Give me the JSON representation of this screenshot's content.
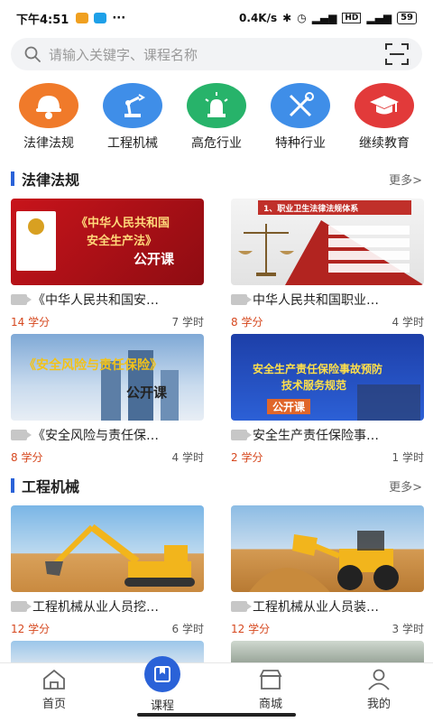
{
  "status": {
    "time": "下午4:51",
    "net": "0.4K/s",
    "battery": "59"
  },
  "search": {
    "placeholder": "请输入关键字、课程名称"
  },
  "categories": [
    {
      "label": "法律法规",
      "icon": "worker-helmet-icon",
      "color": "#f07a2a"
    },
    {
      "label": "工程机械",
      "icon": "robot-arm-icon",
      "color": "#3f8ee8"
    },
    {
      "label": "高危行业",
      "icon": "warning-light-icon",
      "color": "#27b36a"
    },
    {
      "label": "特种行业",
      "icon": "tools-icon",
      "color": "#3f8ee8"
    },
    {
      "label": "继续教育",
      "icon": "graduation-cap-icon",
      "color": "#e23a3a"
    }
  ],
  "sections": [
    {
      "title": "法律法规",
      "more": "更多>",
      "courses": [
        {
          "title": "《中华人民共和国安…",
          "credit": "14 学分",
          "hours": "7 学时",
          "thumb_l1": "《中华人民共和国",
          "thumb_l2": "安全生产法》",
          "thumb_l3": "公开课"
        },
        {
          "title": "中华人民共和国职业…",
          "credit": "8 学分",
          "hours": "4 学时",
          "thumb_l1": "1、职业卫生法律法规体系"
        },
        {
          "title": "《安全风险与责任保…",
          "credit": "8 学分",
          "hours": "4 学时",
          "thumb_l1": "《安全风险与责任保险》",
          "thumb_l2": "公开课"
        },
        {
          "title": "安全生产责任保险事…",
          "credit": "2 学分",
          "hours": "1 学时",
          "thumb_l1": "安全生产责任保险事故预防",
          "thumb_l2": "技术服务规范",
          "thumb_l3": "公开课"
        }
      ]
    },
    {
      "title": "工程机械",
      "more": "更多>",
      "courses": [
        {
          "title": "工程机械从业人员挖…",
          "credit": "12 学分",
          "hours": "6 学时"
        },
        {
          "title": "工程机械从业人员装…",
          "credit": "12 学分",
          "hours": "3 学时"
        }
      ]
    }
  ],
  "nav": [
    {
      "label": "首页",
      "icon": "home-icon"
    },
    {
      "label": "课程",
      "icon": "book-icon"
    },
    {
      "label": "商城",
      "icon": "shop-icon"
    },
    {
      "label": "我的",
      "icon": "user-icon"
    }
  ],
  "colors": {
    "accent": "#2a62d8",
    "credit": "#d6481f"
  }
}
